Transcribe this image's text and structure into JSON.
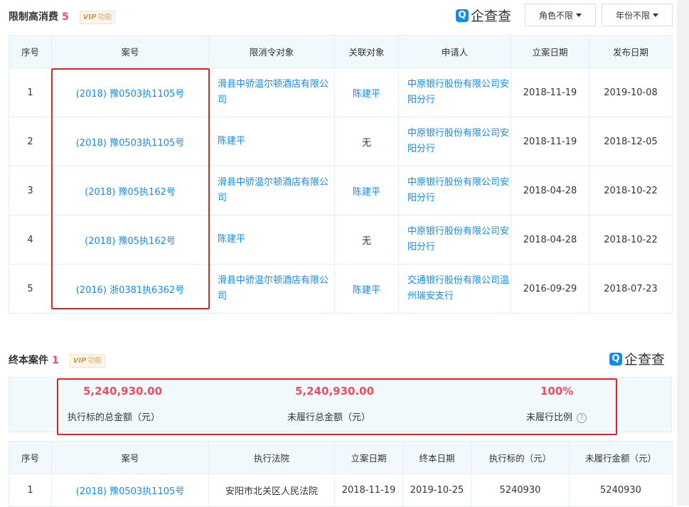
{
  "s1": {
    "title": "限制高消费",
    "count": "5",
    "vip_label": "功能",
    "brand": "企查查",
    "filter_role": "角色不限",
    "filter_year": "年份不限",
    "headers": [
      "序号",
      "案号",
      "限消令对象",
      "关联对象",
      "申请人",
      "立案日期",
      "发布日期"
    ],
    "rows": [
      {
        "no": "1",
        "case": "(2018) 豫0503执1105号",
        "target": "滑县中骄温尔顿酒店有限公司",
        "related": "陈建平",
        "applicant": "中原银行股份有限公司安阳分行",
        "filed": "2018-11-19",
        "published": "2019-10-08"
      },
      {
        "no": "2",
        "case": "(2018) 豫0503执1105号",
        "target": "陈建平",
        "related": "无",
        "applicant": "中原银行股份有限公司安阳分行",
        "filed": "2018-11-19",
        "published": "2018-12-05"
      },
      {
        "no": "3",
        "case": "(2018) 豫05执162号",
        "target": "滑县中骄温尔顿酒店有限公司",
        "related": "陈建平",
        "applicant": "中原银行股份有限公司安阳分行",
        "filed": "2018-04-28",
        "published": "2018-10-22"
      },
      {
        "no": "4",
        "case": "(2018) 豫05执162号",
        "target": "陈建平",
        "related": "无",
        "applicant": "中原银行股份有限公司安阳分行",
        "filed": "2018-04-28",
        "published": "2018-10-22"
      },
      {
        "no": "5",
        "case": "(2016) 浙0381执6362号",
        "target": "滑县中骄温尔顿酒店有限公司",
        "related": "陈建平",
        "applicant": "交通银行股份有限公司温州瑞安支行",
        "filed": "2016-09-29",
        "published": "2018-07-23"
      }
    ]
  },
  "s2": {
    "title": "终本案件",
    "count": "1",
    "vip_label": "功能",
    "brand": "企查查",
    "summary": {
      "total_value": "5,240,930.00",
      "total_label": "执行标的总金额（元）",
      "unpaid_value": "5,240,930.00",
      "unpaid_label": "未履行总金额（元）",
      "ratio_value": "100%",
      "ratio_label": "未履行比例"
    },
    "headers": [
      "序号",
      "案号",
      "执行法院",
      "立案日期",
      "终本日期",
      "执行标的（元）",
      "未履行金额（元）"
    ],
    "rows": [
      {
        "no": "1",
        "case": "(2018) 豫0503执1105号",
        "court": "安阳市北关区人民法院",
        "filed": "2018-11-19",
        "ended": "2019-10-25",
        "amount": "5240930",
        "unpaid": "5240930"
      }
    ]
  }
}
